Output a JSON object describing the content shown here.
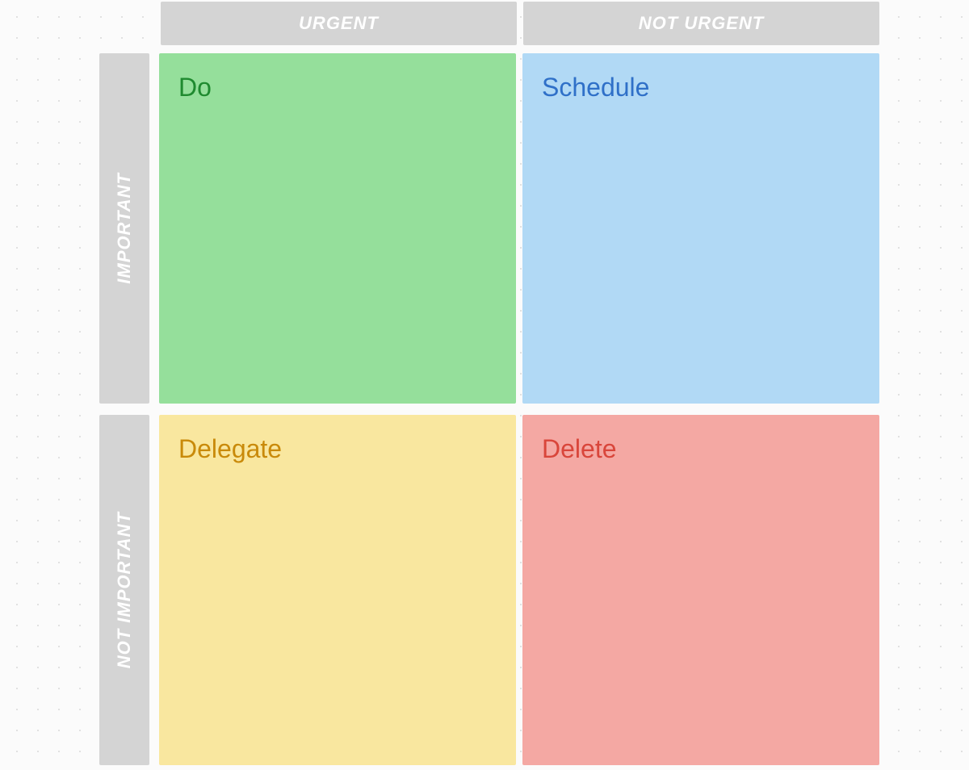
{
  "columns": {
    "urgent": "URGENT",
    "not_urgent": "NOT URGENT"
  },
  "rows": {
    "important": "IMPORTANT",
    "not_important": "NOT IMPORTANT"
  },
  "quadrants": {
    "do": {
      "title": "Do"
    },
    "schedule": {
      "title": "Schedule"
    },
    "delegate": {
      "title": "Delegate"
    },
    "delete": {
      "title": "Delete"
    }
  }
}
